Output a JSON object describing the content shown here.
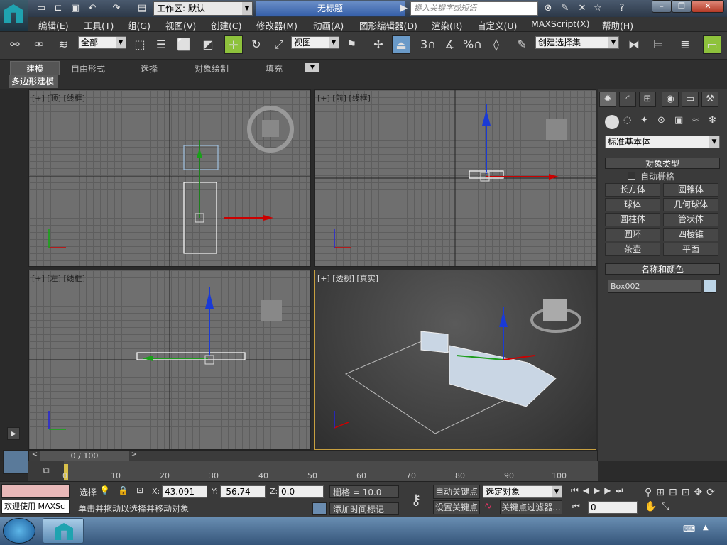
{
  "app": {
    "workspace_label": "工作区: 默认",
    "doc_title": "无标题",
    "search_placeholder": "键入关键字或短语"
  },
  "menu": [
    "编辑(E)",
    "工具(T)",
    "组(G)",
    "视图(V)",
    "创建(C)",
    "修改器(M)",
    "动画(A)",
    "图形编辑器(D)",
    "渲染(R)",
    "自定义(U)",
    "MAXScript(X)",
    "帮助(H)"
  ],
  "toolbar": {
    "filter_value": "全部",
    "ref_coord_value": "视图",
    "named_selection_value": "创建选择集",
    "snap_3": "3",
    "snap_pct": "%"
  },
  "ribbon": {
    "tabs": [
      "建模",
      "自由形式",
      "选择",
      "对象绘制",
      "填充"
    ],
    "sub_label": "多边形建模"
  },
  "viewports": {
    "top": {
      "label": "[+] [顶] [线框]"
    },
    "front": {
      "label": "[+] [前] [线框]"
    },
    "left": {
      "label": "[+] [左] [线框]"
    },
    "persp": {
      "label": "[+] [透视] [真实]"
    }
  },
  "cmdpanel": {
    "dropdown_value": "标准基本体",
    "rollout_object_type": "对象类型",
    "autogrid_label": "自动栅格",
    "object_buttons": [
      "长方体",
      "圆锥体",
      "球体",
      "几何球体",
      "圆柱体",
      "管状体",
      "圆环",
      "四棱锥",
      "茶壶",
      "平面"
    ],
    "rollout_name_color": "名称和颜色",
    "object_name": "Box002",
    "object_color": "#bcd4e6"
  },
  "timeline": {
    "frame_display": "0 / 100",
    "ticks": [
      "10",
      "20",
      "30",
      "40",
      "50",
      "60",
      "70",
      "80",
      "90",
      "100"
    ],
    "frame_zero": "0"
  },
  "status": {
    "maxscript_text": "欢迎使用 MAXSc",
    "select_label": "选择",
    "x_label": "X:",
    "x_value": "43.091",
    "y_label": "Y:",
    "y_value": "-56.74",
    "z_label": "Z:",
    "z_value": "0.0",
    "grid_label": "栅格 = 10.0",
    "prompt": "单击并拖动以选择并移动对象",
    "add_time_tag": "添加时间标记",
    "auto_key": "自动关键点",
    "set_key": "设置关键点",
    "key_mode_value": "选定对象",
    "key_filters": "关键点过滤器...",
    "current_frame": "0"
  }
}
